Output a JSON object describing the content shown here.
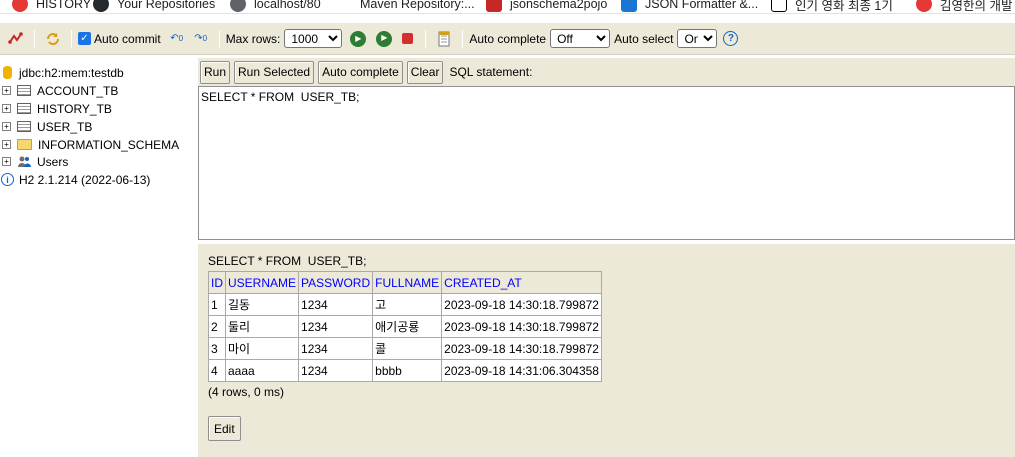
{
  "bookmarks": [
    {
      "label": "HISTORY",
      "icon": "red-circle-icon"
    },
    {
      "label": "Your Repositories",
      "icon": "github-icon"
    },
    {
      "label": "localhost/80",
      "icon": "globe-icon"
    },
    {
      "label": "Maven Repository:...",
      "icon": "maven-icon"
    },
    {
      "label": "jsonschema2pojo",
      "icon": "json-icon"
    },
    {
      "label": "JSON Formatter &...",
      "icon": "checkmark-icon"
    },
    {
      "label": "인기 영화 최종 1기",
      "icon": "notion-icon"
    },
    {
      "label": "김영한의 개발",
      "icon": "red-circle-icon"
    }
  ],
  "toolbar": {
    "auto_commit_label": "Auto commit",
    "auto_commit_checked": true,
    "max_rows_label": "Max rows:",
    "max_rows_value": "1000",
    "auto_complete_label": "Auto complete",
    "auto_complete_value": "Off",
    "auto_select_label": "Auto select",
    "auto_select_value": "On"
  },
  "tree": {
    "connection": "jdbc:h2:mem:testdb",
    "items": [
      {
        "label": "ACCOUNT_TB",
        "type": "table"
      },
      {
        "label": "HISTORY_TB",
        "type": "table"
      },
      {
        "label": "USER_TB",
        "type": "table"
      },
      {
        "label": "INFORMATION_SCHEMA",
        "type": "folder"
      },
      {
        "label": "Users",
        "type": "users"
      }
    ],
    "version": "H2 2.1.214 (2022-06-13)"
  },
  "query_bar": {
    "run": "Run",
    "run_selected": "Run Selected",
    "auto_complete": "Auto complete",
    "clear": "Clear",
    "sql_label": "SQL statement:"
  },
  "editor": {
    "sql": "SELECT * FROM  USER_TB;"
  },
  "result": {
    "title": "SELECT * FROM  USER_TB;",
    "columns": [
      "ID",
      "USERNAME",
      "PASSWORD",
      "FULLNAME",
      "CREATED_AT"
    ],
    "rows": [
      [
        "1",
        "길동",
        "1234",
        "고",
        "2023-09-18 14:30:18.799872"
      ],
      [
        "2",
        "둘리",
        "1234",
        "애기공룡",
        "2023-09-18 14:30:18.799872"
      ],
      [
        "3",
        "마이",
        "1234",
        "콜",
        "2023-09-18 14:30:18.799872"
      ],
      [
        "4",
        "aaaa",
        "1234",
        "bbbb",
        "2023-09-18 14:31:06.304358"
      ]
    ],
    "row_count": "(4 rows, 0 ms)",
    "edit_label": "Edit"
  }
}
